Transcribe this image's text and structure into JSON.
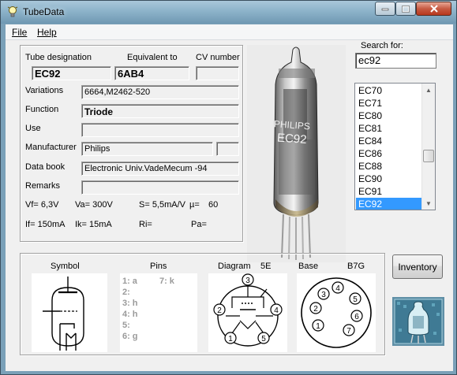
{
  "window": {
    "title": "TubeData"
  },
  "menu": {
    "file": "File",
    "help": "Help"
  },
  "labels": {
    "tube_designation": "Tube designation",
    "equivalent_to": "Equivalent to",
    "cv_number": "CV number",
    "variations": "Variations",
    "function": "Function",
    "use": "Use",
    "manufacturer": "Manufacturer",
    "data_book": "Data book",
    "remarks": "Remarks",
    "search_for": "Search for:",
    "symbol": "Symbol",
    "pins": "Pins",
    "diagram": "Diagram",
    "diagram_code": "5E",
    "base": "Base",
    "base_code": "B7G",
    "inventory": "Inventory"
  },
  "tube": {
    "designation": "EC92",
    "equivalent": "6AB4",
    "cv_number": "",
    "variations": "6664,M2462-520",
    "function": "Triode",
    "use": "",
    "manufacturer": "Philips",
    "manufacturer_code": "",
    "data_book": "Electronic Univ.VadeMecum -94",
    "remarks": ""
  },
  "specs": {
    "vf": "Vf= 6,3V",
    "va": "Va=  300V",
    "s": "S= 5,5mA/V",
    "mu": "µ=",
    "mu_value": "60",
    "if": "If= 150mA",
    "ik": "Ik=   15mA",
    "ri": "Ri=",
    "pa": "Pa="
  },
  "search": {
    "value": "ec92"
  },
  "tube_list": [
    "EC70",
    "EC71",
    "EC80",
    "EC81",
    "EC84",
    "EC86",
    "EC88",
    "EC90",
    "EC91",
    "EC92"
  ],
  "selected_tube": "EC92",
  "pins": [
    {
      "num": "1:",
      "val": "a"
    },
    {
      "num": "2:",
      "val": ""
    },
    {
      "num": "3:",
      "val": "h"
    },
    {
      "num": "4:",
      "val": "h"
    },
    {
      "num": "5:",
      "val": ""
    },
    {
      "num": "6:",
      "val": "g"
    },
    {
      "num": "7:",
      "val": "k"
    }
  ],
  "photo_text": {
    "brand": "PHILIPS",
    "code": "EC92"
  },
  "diagram_pins": [
    "1",
    "2",
    "3",
    "4",
    "5"
  ],
  "base_pins": [
    "1",
    "2",
    "3",
    "4",
    "5",
    "6",
    "7"
  ],
  "icons": {
    "app": "light-bulb-icon",
    "minimize": "minimize-icon",
    "maximize": "maximize-icon",
    "close": "close-icon",
    "scroll_up": "scroll-up-arrow-icon",
    "scroll_down": "scroll-down-arrow-icon",
    "logo": "tubedata-logo-icon"
  },
  "colors": {
    "selection": "#3399ff",
    "title_bar": "#8db3ca",
    "close_button": "#c75b43",
    "window_bg": "#f0f0f0"
  }
}
